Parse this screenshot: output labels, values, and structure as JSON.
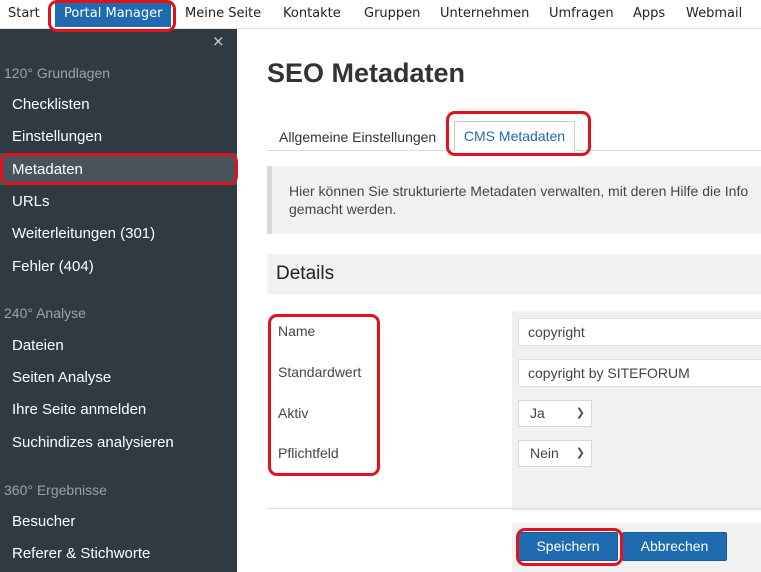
{
  "topnav": {
    "items": [
      "Start",
      "Portal Manager",
      "Meine Seite",
      "Kontakte",
      "Gruppen",
      "Unternehmen",
      "Umfragen",
      "Apps",
      "Webmail"
    ],
    "active": "Portal Manager"
  },
  "sidebar": {
    "close_icon": "×",
    "sections": [
      {
        "title": "120° Grundlagen",
        "items": [
          "Checklisten",
          "Einstellungen",
          "Metadaten",
          "URLs",
          "Weiterleitungen (301)",
          "Fehler (404)"
        ]
      },
      {
        "title": "240° Analyse",
        "items": [
          "Dateien",
          "Seiten Analyse",
          "Ihre Seite anmelden",
          "Suchindizes analysieren"
        ]
      },
      {
        "title": "360° Ergebnisse",
        "items": [
          "Besucher",
          "Referer & Stichworte"
        ]
      }
    ],
    "active_item": "Metadaten"
  },
  "main": {
    "title": "SEO Metadaten",
    "tabs": [
      "Allgemeine Einstellungen",
      "CMS Metadaten"
    ],
    "active_tab": "CMS Metadaten",
    "info": "Hier können Sie strukturierte Metadaten verwalten, mit deren Hilfe die Info",
    "info_line2": "gemacht werden.",
    "details_title": "Details",
    "form": {
      "name_label": "Name",
      "name_value": "copyright",
      "default_label": "Standardwert",
      "default_value": "copyright by SITEFORUM",
      "active_label": "Aktiv",
      "active_value": "Ja",
      "required_label": "Pflichtfeld",
      "required_value": "Nein"
    },
    "buttons": {
      "save": "Speichern",
      "cancel": "Abbrechen"
    }
  },
  "colors": {
    "accent": "#1f6bb0",
    "sidebar_bg": "#303a42",
    "highlight": "#e0121c"
  }
}
